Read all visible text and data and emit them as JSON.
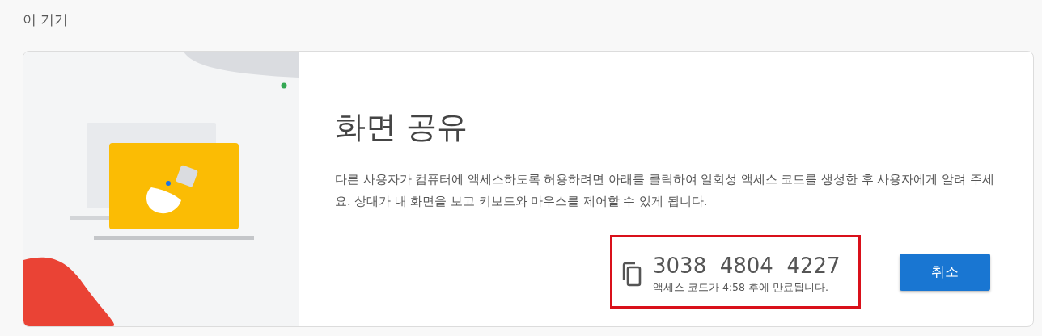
{
  "section_title": "이 기기",
  "card": {
    "heading": "화면 공유",
    "description": "다른 사용자가 컴퓨터에 액세스하도록 허용하려면 아래를 클릭하여 일회성 액세스 코드를 생성한 후 사용자에게 알려 주세요. 상대가 내 화면을 보고 키보드와 마우스를 제어할 수 있게 됩니다.",
    "access_code": {
      "highlighted": true,
      "code": "3038  4804  4227",
      "expiry": "액세스 코드가 4:58 후에 만료됩니다."
    },
    "buttons": [
      {
        "label": "취소"
      }
    ]
  }
}
